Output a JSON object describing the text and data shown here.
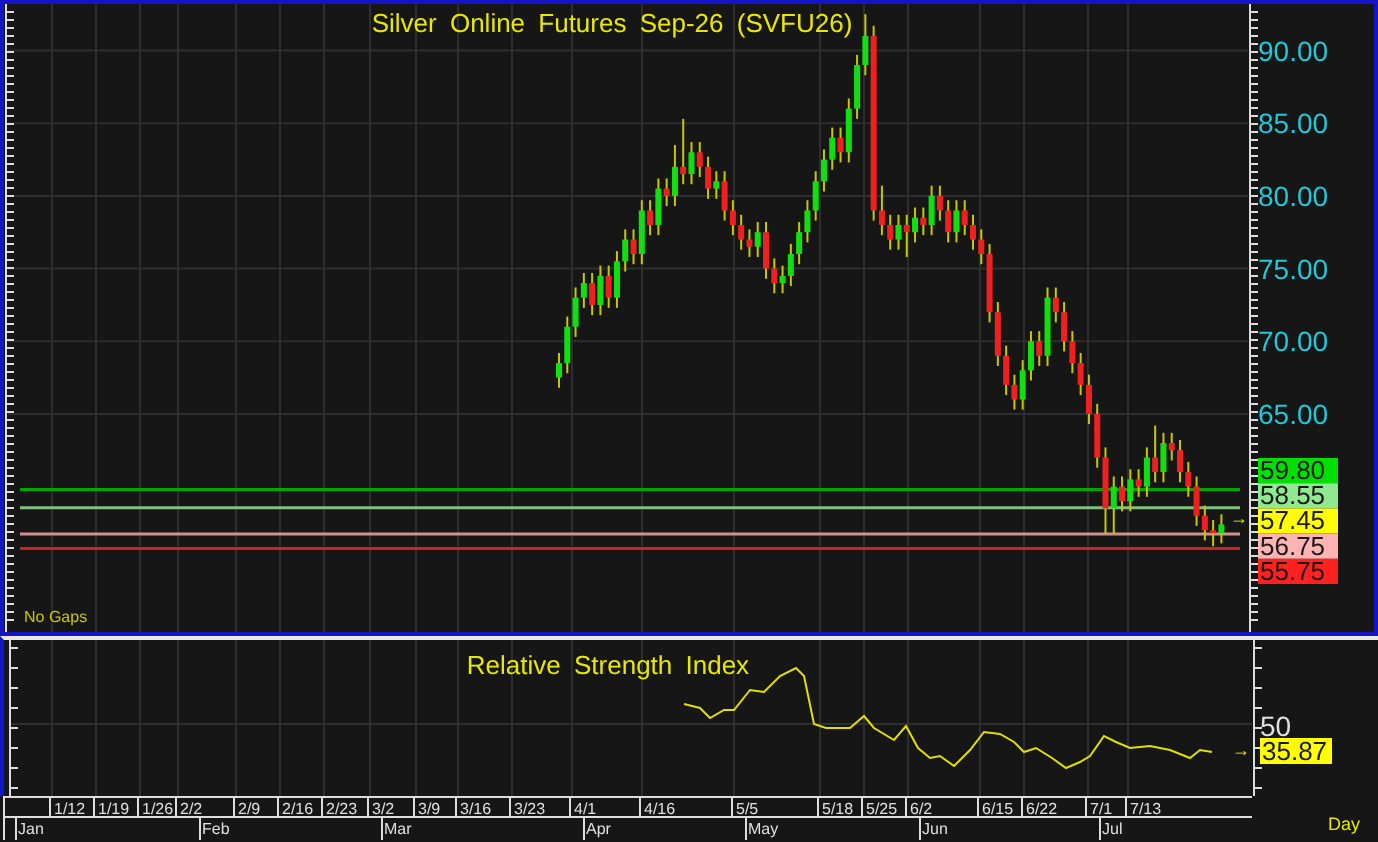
{
  "price_panel": {
    "title": "Silver Online Futures Sep-26 (SVFU26)",
    "note": "No Gaps",
    "chart_data": {
      "type": "candlestick",
      "ylim": [
        50,
        93.2
      ],
      "grid": true,
      "ref_lines": [
        {
          "axis": "y",
          "value": 59.8,
          "color": "#00a800"
        },
        {
          "axis": "y",
          "value": 58.55,
          "color": "#80c080"
        },
        {
          "axis": "y",
          "value": 56.75,
          "color": "#d09090"
        },
        {
          "axis": "y",
          "value": 55.75,
          "color": "#d02020"
        }
      ],
      "yticks": [
        {
          "value": 90,
          "label": "90.00"
        },
        {
          "value": 85,
          "label": "85.00"
        },
        {
          "value": 80,
          "label": "80.00"
        },
        {
          "value": 75,
          "label": "75.00"
        },
        {
          "value": 70,
          "label": "70.00"
        },
        {
          "value": 65,
          "label": "65.00"
        }
      ],
      "ohlc": [
        [
          67.5,
          69.2,
          66.8,
          68.5
        ],
        [
          68.5,
          71.7,
          67.8,
          71
        ],
        [
          71,
          73.7,
          70.3,
          73
        ],
        [
          73,
          74.7,
          72.3,
          74
        ],
        [
          74,
          74.7,
          71.8,
          72.5
        ],
        [
          72.5,
          75.2,
          71.8,
          74.5
        ],
        [
          74.5,
          75.2,
          72.3,
          73
        ],
        [
          73,
          76.2,
          72.3,
          75.5
        ],
        [
          75.5,
          77.7,
          74.8,
          77
        ],
        [
          77,
          77.7,
          75.3,
          76
        ],
        [
          76,
          79.7,
          75.3,
          79
        ],
        [
          79,
          79.7,
          77.3,
          78
        ],
        [
          78,
          81.2,
          77.3,
          80.5
        ],
        [
          80.5,
          81.2,
          79.3,
          80
        ],
        [
          80,
          83.5,
          79.3,
          82
        ],
        [
          82,
          85.3,
          80.8,
          81.5
        ],
        [
          81.5,
          83.7,
          80.8,
          83
        ],
        [
          83,
          83.7,
          81.3,
          82
        ],
        [
          82,
          82.7,
          79.8,
          80.5
        ],
        [
          80.5,
          81.7,
          79.8,
          81
        ],
        [
          81,
          81.7,
          78.3,
          79
        ],
        [
          79,
          79.7,
          77.3,
          78
        ],
        [
          78,
          78.7,
          76.3,
          77
        ],
        [
          77,
          77.7,
          75.8,
          76.5
        ],
        [
          76.5,
          78.2,
          75.8,
          77.5
        ],
        [
          77.5,
          78.2,
          74.3,
          75
        ],
        [
          75,
          75.7,
          73.3,
          74
        ],
        [
          74,
          75.2,
          73.3,
          74.5
        ],
        [
          74.5,
          76.7,
          73.8,
          76
        ],
        [
          76,
          78.2,
          75.3,
          77.5
        ],
        [
          77.5,
          79.7,
          76.8,
          79
        ],
        [
          79,
          81.7,
          78.3,
          81
        ],
        [
          81,
          83.2,
          80.3,
          82.5
        ],
        [
          82.5,
          84.7,
          81.8,
          84
        ],
        [
          84,
          84.7,
          82.3,
          83
        ],
        [
          83,
          86.7,
          82.3,
          86
        ],
        [
          86,
          89.7,
          85.3,
          89
        ],
        [
          89,
          92.5,
          88.3,
          91
        ],
        [
          91,
          91.7,
          78.3,
          79
        ],
        [
          79,
          80.7,
          77.3,
          78
        ],
        [
          78,
          78.7,
          76.3,
          77
        ],
        [
          77,
          78.7,
          76.3,
          78
        ],
        [
          78,
          78.7,
          75.8,
          77.5
        ],
        [
          77.5,
          79.2,
          76.8,
          78.5
        ],
        [
          78.5,
          79.2,
          77.3,
          78
        ],
        [
          78,
          80.7,
          77.3,
          80
        ],
        [
          80,
          80.7,
          78.3,
          79
        ],
        [
          79,
          79.7,
          76.8,
          77.5
        ],
        [
          77.5,
          79.7,
          76.8,
          79
        ],
        [
          79,
          79.7,
          77.3,
          78
        ],
        [
          78,
          78.7,
          76.3,
          77
        ],
        [
          77,
          77.7,
          75.3,
          76
        ],
        [
          76,
          76.7,
          71.3,
          72
        ],
        [
          72,
          72.7,
          68.3,
          69
        ],
        [
          69,
          69.7,
          66.3,
          67
        ],
        [
          67,
          67.7,
          65.3,
          66
        ],
        [
          66,
          68.7,
          65.3,
          68
        ],
        [
          68,
          70.7,
          67.3,
          70
        ],
        [
          70,
          70.7,
          68.3,
          69
        ],
        [
          69,
          73.7,
          68.3,
          73
        ],
        [
          73,
          73.7,
          71.3,
          72
        ],
        [
          72,
          72.7,
          69.3,
          70
        ],
        [
          70,
          70.7,
          67.8,
          68.5
        ],
        [
          68.5,
          69.2,
          66.3,
          67
        ],
        [
          67,
          67.7,
          64.3,
          65
        ],
        [
          65,
          65.7,
          61.3,
          62
        ],
        [
          62,
          62.7,
          56.8,
          58.5
        ],
        [
          58.5,
          60.7,
          56.8,
          60
        ],
        [
          60,
          60.7,
          58.3,
          59
        ],
        [
          59,
          61.2,
          58.3,
          60.5
        ],
        [
          60.5,
          61.2,
          59.3,
          60
        ],
        [
          60,
          62.7,
          59.3,
          62
        ],
        [
          62,
          64.2,
          60.3,
          61
        ],
        [
          61,
          63.7,
          60.3,
          63
        ],
        [
          63,
          63.7,
          61.8,
          62.5
        ],
        [
          62.5,
          63.2,
          60.3,
          61
        ],
        [
          61,
          61.7,
          59.3,
          60
        ],
        [
          60,
          60.7,
          57.3,
          58
        ],
        [
          58,
          58.7,
          56.3,
          57
        ],
        [
          57,
          57.7,
          55.9,
          56.8
        ],
        [
          56.8,
          58.1,
          56.1,
          57.4
        ]
      ]
    },
    "levels": [
      {
        "label": "59.80",
        "color": "#00e000"
      },
      {
        "label": "58.55",
        "color": "#90e890"
      },
      {
        "label": "57.45",
        "color": "#ffff00",
        "marker": "→"
      },
      {
        "label": "56.75",
        "color": "#ffb4b4"
      },
      {
        "label": "55.75",
        "color": "#ff2020"
      }
    ]
  },
  "rsi_panel": {
    "title": "Relative Strength Index",
    "axis_label": "50",
    "last_value": "35.87",
    "marker": "→"
  },
  "time_axis": {
    "weeks": [
      "1/12",
      "1/19",
      "1/26",
      "2/2",
      "2/9",
      "2/16",
      "2/23",
      "3/2",
      "3/9",
      "3/16",
      "3/23",
      "4/1",
      "4/16",
      "5/5",
      "5/18",
      "5/25",
      "6/2",
      "6/15",
      "6/22",
      "7/1",
      "7/13"
    ],
    "months": [
      "Jan",
      "Feb",
      "Mar",
      "Apr",
      "May",
      "Jun",
      "Jul"
    ],
    "interval": "Day"
  }
}
